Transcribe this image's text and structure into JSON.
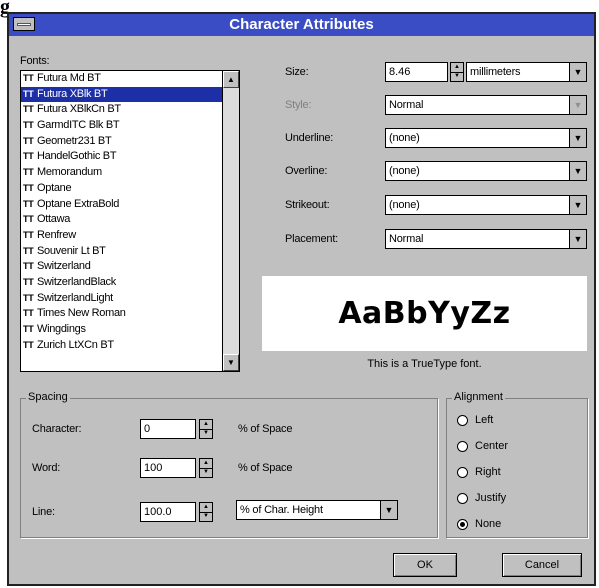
{
  "corner_text": "g",
  "title": "Character Attributes",
  "fonts": {
    "label": "Fonts:",
    "items": [
      {
        "name": "Futura Md BT"
      },
      {
        "name": "Futura XBlk BT",
        "selected": true
      },
      {
        "name": "Futura XBlkCn BT"
      },
      {
        "name": "GarmdITC Blk BT"
      },
      {
        "name": "Geometr231 BT"
      },
      {
        "name": "HandelGothic BT"
      },
      {
        "name": "Memorandum"
      },
      {
        "name": "Optane"
      },
      {
        "name": "Optane ExtraBold"
      },
      {
        "name": "Ottawa"
      },
      {
        "name": "Renfrew"
      },
      {
        "name": "Souvenir Lt BT"
      },
      {
        "name": "Switzerland"
      },
      {
        "name": "SwitzerlandBlack"
      },
      {
        "name": "SwitzerlandLight"
      },
      {
        "name": "Times New Roman"
      },
      {
        "name": "Wingdings"
      },
      {
        "name": "Zurich LtXCn BT"
      }
    ]
  },
  "size": {
    "label": "Size:",
    "value": "8.46",
    "unit": "millimeters"
  },
  "style": {
    "label": "Style:",
    "value": "Normal",
    "disabled": true
  },
  "underline": {
    "label": "Underline:",
    "value": "(none)"
  },
  "overline": {
    "label": "Overline:",
    "value": "(none)"
  },
  "strikeout": {
    "label": "Strikeout:",
    "value": "(none)"
  },
  "placement": {
    "label": "Placement:",
    "value": "Normal"
  },
  "preview": {
    "sample": "AaBbYyZz",
    "note": "This is a TrueType font."
  },
  "spacing": {
    "title": "Spacing",
    "character": {
      "label": "Character:",
      "value": "0",
      "unit": "% of Space"
    },
    "word": {
      "label": "Word:",
      "value": "100",
      "unit": "% of Space"
    },
    "line": {
      "label": "Line:",
      "value": "100.0",
      "unit": "% of Char. Height"
    }
  },
  "alignment": {
    "title": "Alignment",
    "options": [
      {
        "label": "Left",
        "checked": false
      },
      {
        "label": "Center",
        "checked": false
      },
      {
        "label": "Right",
        "checked": false
      },
      {
        "label": "Justify",
        "checked": false
      },
      {
        "label": "None",
        "checked": true
      }
    ]
  },
  "buttons": {
    "ok": "OK",
    "cancel": "Cancel"
  },
  "icons": {
    "truetype": "TT",
    "up": "▲",
    "down": "▼"
  }
}
